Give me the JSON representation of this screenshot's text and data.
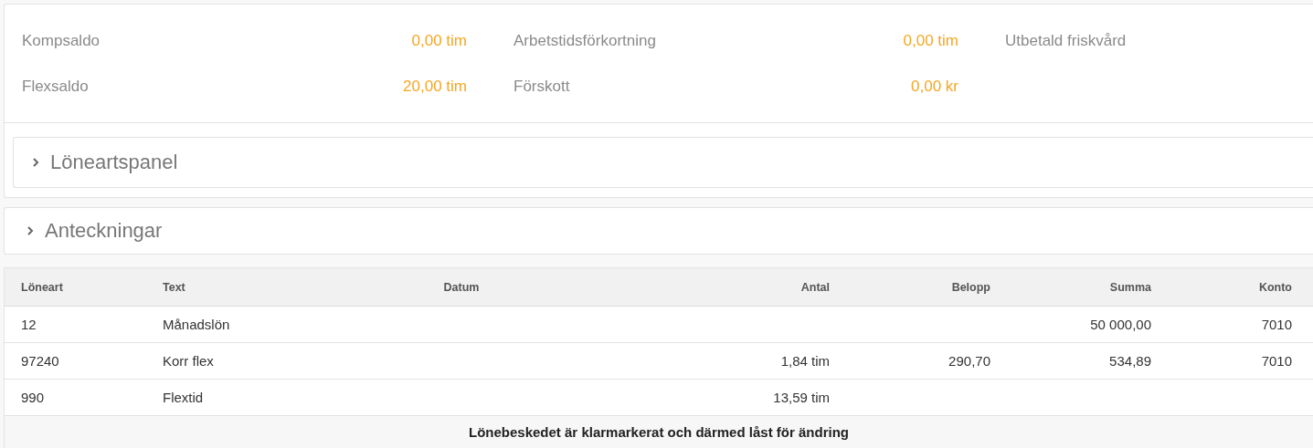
{
  "summary": [
    {
      "label": "Kompsaldo",
      "value": "0,00 tim"
    },
    {
      "label": "Arbetstidsförkortning",
      "value": "0,00 tim"
    },
    {
      "label": "Utbetald friskvård"
    },
    {
      "label": "Flexsaldo",
      "value": "20,00 tim"
    },
    {
      "label": "Förskott",
      "value": "0,00 kr"
    }
  ],
  "wage_type_panel": {
    "title": "Löneartspanel",
    "expanded": false
  },
  "notes_panel": {
    "title": "Anteckningar",
    "expanded": false
  },
  "table": {
    "columns": [
      "Löneart",
      "Text",
      "Datum",
      "Antal",
      "Belopp",
      "Summa",
      "Konto"
    ],
    "rows": [
      [
        "12",
        "Månadslön",
        "",
        "",
        "",
        "50 000,00",
        "7010"
      ],
      [
        "97240",
        "Korr flex",
        "",
        "1,84 tim",
        "290,70",
        "534,89",
        "7010"
      ],
      [
        "990",
        "Flextid",
        "",
        "13,59 tim",
        "",
        "",
        ""
      ]
    ],
    "footer": "Lönebeskedet är klarmarkerat och därmed låst för ändring"
  }
}
